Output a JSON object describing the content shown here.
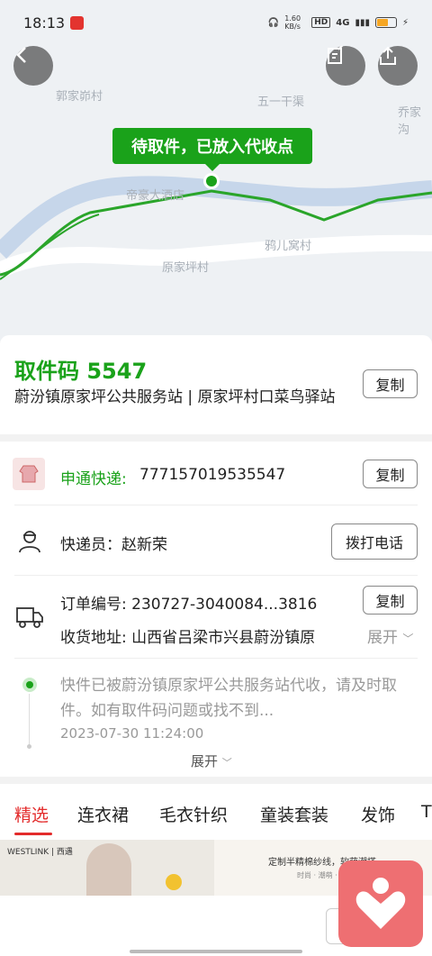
{
  "status_bar": {
    "time": "18:13",
    "net_speed": "1.60 KB/s",
    "hd": "HD",
    "signal": "4G"
  },
  "map": {
    "labels": [
      "郭家峁村",
      "五一干渠",
      "乔家沟",
      "帝豪大酒店",
      "鸦儿窝村",
      "原家坪村"
    ],
    "status_pill": "待取件，已放入代收点"
  },
  "pickup": {
    "code_label": "取件码 5547",
    "station": "蔚汾镇原家坪公共服务站 | 原家坪村口菜鸟驿站",
    "copy_label": "复制"
  },
  "courier": {
    "company": "申通快递:",
    "tracking_no": "777157019535547",
    "copy_label": "复制",
    "person_label": "快递员：赵新荣",
    "call_label": "拨打电话"
  },
  "order": {
    "order_no": "订单编号: 230727-3040084...3816",
    "copy_label": "复制",
    "address": "收货地址: 山西省吕梁市兴县蔚汾镇原",
    "expand_label": "展开"
  },
  "timeline": {
    "text": "快件已被蔚汾镇原家坪公共服务站代收，请及时取件。如有取件码问题或找不到...",
    "time": "2023-07-30 11:24:00",
    "expand_label": "展开"
  },
  "tabs": [
    "精选",
    "连衣裙",
    "毛衣针织",
    "童装套装",
    "发饰",
    "T"
  ],
  "banner": {
    "brand": "WESTLINK | 西遇",
    "slogan": "定制半精棉纱线，软萌潮搭",
    "tags": "时尚 · 潮萌 · 软糯"
  },
  "colors": {
    "accent_green": "#1aa21a",
    "tab_red": "#e32b2b"
  }
}
